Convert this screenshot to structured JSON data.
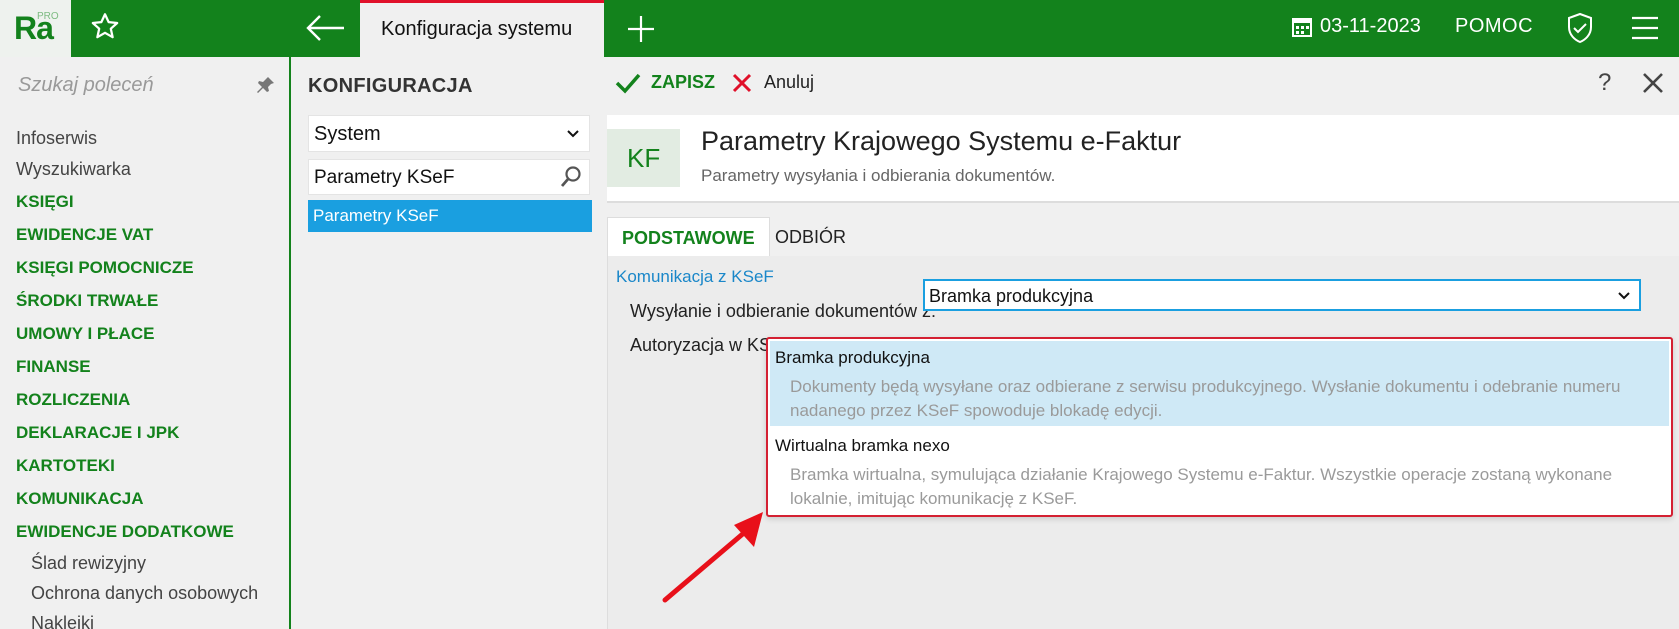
{
  "app": {
    "logo_text": "Ra",
    "logo_badge": "PRO",
    "active_tab": "Konfiguracja systemu",
    "date": "03-11-2023",
    "help_label": "POMOC"
  },
  "leftnav": {
    "search_placeholder": "Szukaj poleceń",
    "items": [
      {
        "label": "Infoserwis",
        "kind": "plain"
      },
      {
        "label": "Wyszukiwarka",
        "kind": "plain"
      },
      {
        "label": "KSIĘGI",
        "kind": "section"
      },
      {
        "label": "EWIDENCJE VAT",
        "kind": "section"
      },
      {
        "label": "KSIĘGI POMOCNICZE",
        "kind": "section"
      },
      {
        "label": "ŚRODKI TRWAŁE",
        "kind": "section"
      },
      {
        "label": "UMOWY I PŁACE",
        "kind": "section"
      },
      {
        "label": "FINANSE",
        "kind": "section"
      },
      {
        "label": "ROZLICZENIA",
        "kind": "section"
      },
      {
        "label": "DEKLARACJE I JPK",
        "kind": "section"
      },
      {
        "label": "KARTOTEKI",
        "kind": "section"
      },
      {
        "label": "KOMUNIKACJA",
        "kind": "section"
      },
      {
        "label": "EWIDENCJE DODATKOWE",
        "kind": "section"
      },
      {
        "label": "Ślad rewizyjny",
        "kind": "sub"
      },
      {
        "label": "Ochrona danych osobowych",
        "kind": "sub"
      },
      {
        "label": "Naklejki",
        "kind": "sub"
      }
    ]
  },
  "config": {
    "title": "KONFIGURACJA",
    "group_select": "System",
    "search_value": "Parametry KSeF",
    "selected_item": "Parametry KSeF"
  },
  "toolbar": {
    "save_label": "ZAPISZ",
    "cancel_label": "Anuluj",
    "help_glyph": "?"
  },
  "header": {
    "badge": "KF",
    "title": "Parametry Krajowego Systemu e-Faktur",
    "subtitle": "Parametry wysyłania i odbierania dokumentów."
  },
  "tabs": [
    "PODSTAWOWE",
    "ODBIÓR"
  ],
  "form": {
    "section_title": "Komunikacja z KSeF",
    "send_label": "Wysyłanie i odbieranie dokumentów z:",
    "auth_label": "Autoryzacja w KS",
    "gateway_value": "Bramka produkcyjna"
  },
  "dropdown": {
    "options": [
      {
        "name": "Bramka produkcyjna",
        "description": "Dokumenty będą wysyłane oraz odbierane z serwisu produkcyjnego. Wysłanie dokumentu i odebranie numeru nadanego przez KSeF spowoduje blokadę edycji."
      },
      {
        "name": "Wirtualna bramka nexo",
        "description": "Bramka wirtualna, symulująca działanie Krajowego Systemu e-Faktur. Wszystkie operacje zostaną wykonane lokalnie, imitując komunikację z KSeF."
      }
    ]
  },
  "colors": {
    "brand_green": "#13821c",
    "accent_blue": "#1a9fe0",
    "highlight_red": "#d42032"
  }
}
